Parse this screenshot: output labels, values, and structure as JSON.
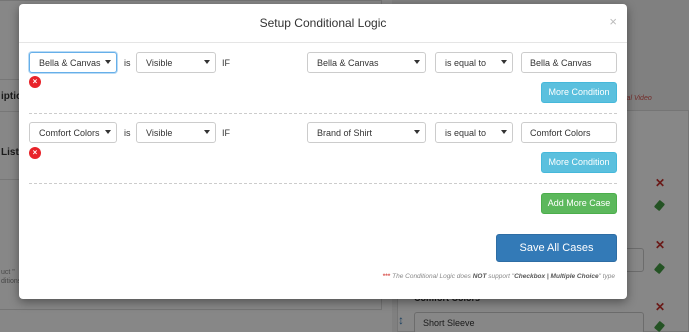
{
  "background": {
    "left_rows": [
      "iption",
      "List"
    ],
    "left_note": [
      "uct \"",
      "ditions"
    ],
    "red_link": "ial Video",
    "field_label": "Comfort Colors *",
    "field_value": "Short Sleeve"
  },
  "modal": {
    "title": "Setup Conditional Logic",
    "close_label": "×",
    "cases": [
      {
        "target_value": "Bella & Canvas",
        "is_word": "is",
        "visibility": "Visible",
        "if_word": "IF",
        "field": "Bella & Canvas",
        "operator": "is equal to",
        "compare_value": "Bella & Canvas",
        "remove_label": "×",
        "more_condition_label": "More Condition"
      },
      {
        "target_value": "Comfort Colors",
        "is_word": "is",
        "visibility": "Visible",
        "if_word": "IF",
        "field": "Brand of Shirt",
        "operator": "is equal to",
        "compare_value": "Comfort Colors",
        "remove_label": "×",
        "more_condition_label": "More Condition"
      }
    ],
    "add_more_case_label": "Add More Case",
    "save_all_label": "Save All Cases",
    "footnote": {
      "stars": "***",
      "text_before": "The Conditional Logic does",
      "not_word": "NOT",
      "text_middle": "support \"",
      "emphasis": "Checkbox | Multiple Choice",
      "text_after": "\" type"
    }
  },
  "colors": {
    "primary": "#337ab7",
    "info": "#5bc0de",
    "success": "#5cb85c",
    "danger": "#e8232a"
  }
}
